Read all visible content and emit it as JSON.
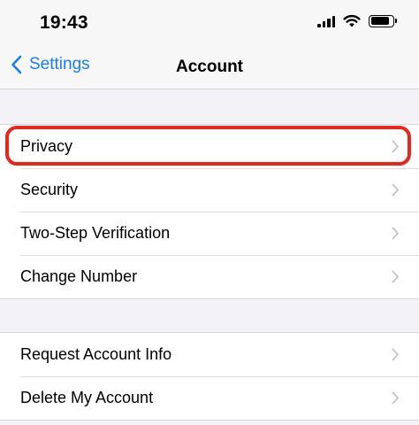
{
  "status_bar": {
    "time": "19:43",
    "signal_icon": "cellular-signal-icon",
    "wifi_icon": "wifi-icon",
    "battery_icon": "battery-icon",
    "battery_level": 0.85
  },
  "nav": {
    "back_label": "Settings",
    "back_icon": "chevron-left-icon",
    "title": "Account",
    "accent_color": "#1a7cf5"
  },
  "groups": [
    {
      "rows": [
        {
          "label": "Privacy",
          "highlighted": true
        },
        {
          "label": "Security"
        },
        {
          "label": "Two-Step Verification"
        },
        {
          "label": "Change Number"
        }
      ]
    },
    {
      "rows": [
        {
          "label": "Request Account Info"
        },
        {
          "label": "Delete My Account"
        }
      ]
    }
  ],
  "row_icon": "chevron-right-icon",
  "highlight_color": "#e8261a"
}
